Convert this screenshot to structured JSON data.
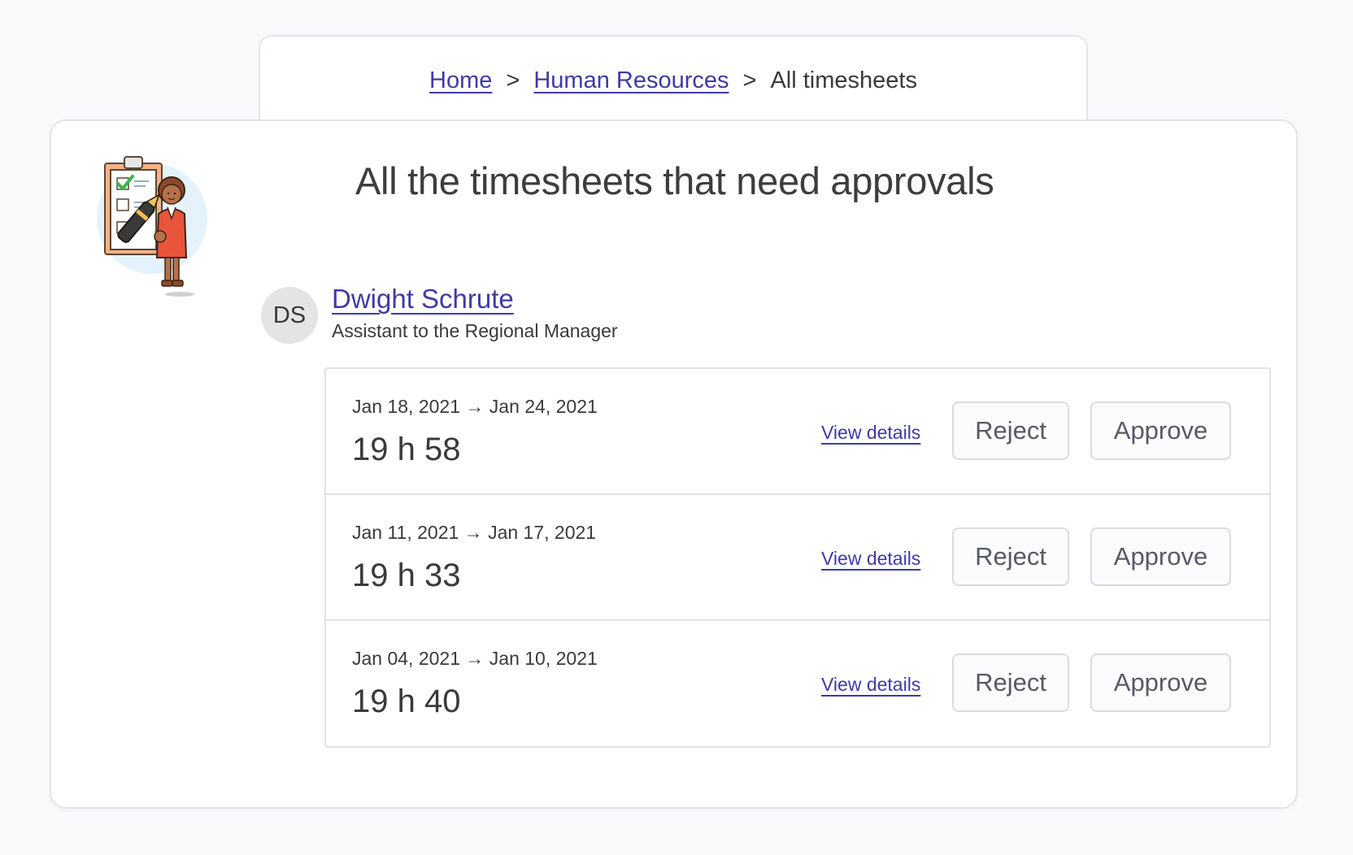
{
  "breadcrumb": {
    "home": "Home",
    "section": "Human Resources",
    "separator": ">",
    "current": "All timesheets"
  },
  "page": {
    "title": "All the timesheets that need approvals"
  },
  "employee": {
    "initials": "DS",
    "name": "Dwight Schrute",
    "role": "Assistant to the Regional Manager"
  },
  "timesheets": [
    {
      "dates": "Jan 18, 2021 → Jan 24, 2021",
      "hours": "19 h 58",
      "view_label": "View details",
      "reject_label": "Reject",
      "approve_label": "Approve"
    },
    {
      "dates": "Jan 11, 2021 → Jan 17, 2021",
      "hours": "19 h 33",
      "view_label": "View details",
      "reject_label": "Reject",
      "approve_label": "Approve"
    },
    {
      "dates": "Jan 04, 2021 → Jan 10, 2021",
      "hours": "19 h 40",
      "view_label": "View details",
      "reject_label": "Reject",
      "approve_label": "Approve"
    }
  ],
  "colors": {
    "link": "#3f3aa6",
    "background": "#f8f9fb",
    "card": "#ffffff",
    "border": "#e3e5ea",
    "avatar_bg": "#e4e4e4"
  }
}
